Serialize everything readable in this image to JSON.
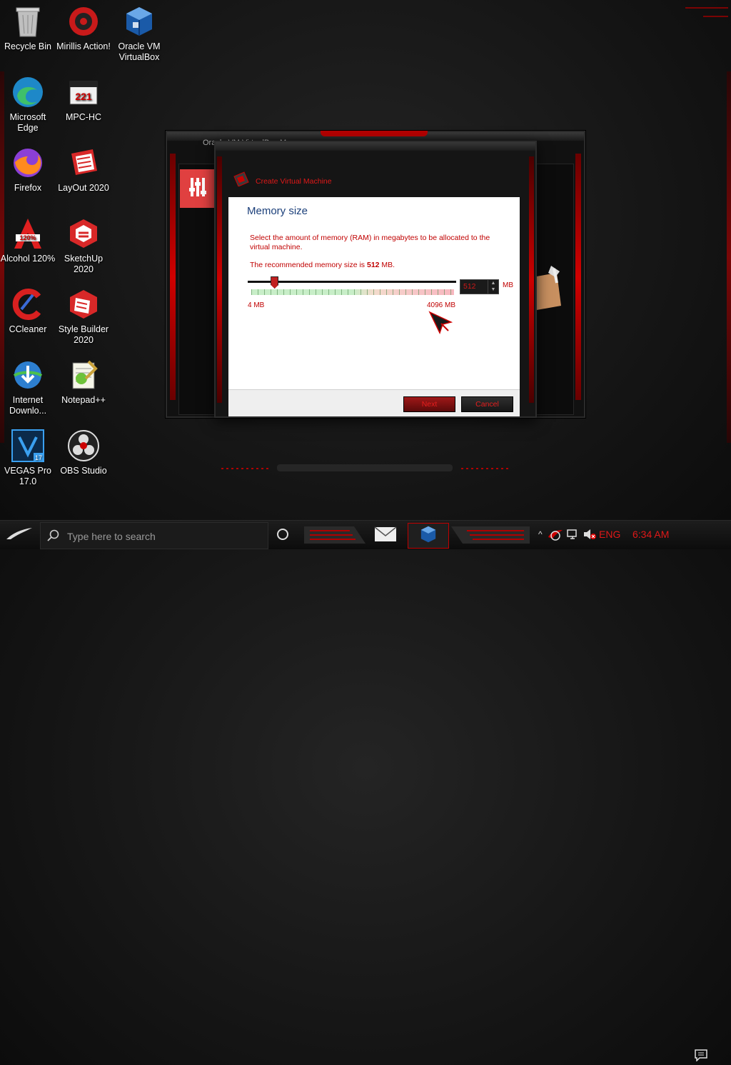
{
  "desktop": {
    "icons": [
      {
        "label": "Recycle Bin"
      },
      {
        "label": "Mirillis Action!"
      },
      {
        "label": "Oracle VM VirtualBox"
      },
      {
        "label": "Microsoft Edge"
      },
      {
        "label": "MPC-HC"
      },
      {
        "label": "Firefox"
      },
      {
        "label": "LayOut 2020"
      },
      {
        "label": "Alcohol 120%"
      },
      {
        "label": "SketchUp 2020"
      },
      {
        "label": "CCleaner"
      },
      {
        "label": "Style Builder 2020"
      },
      {
        "label": "Internet Downlo..."
      },
      {
        "label": "Notepad++"
      },
      {
        "label": "VEGAS Pro 17.0"
      },
      {
        "label": "OBS Studio"
      }
    ]
  },
  "back_window": {
    "title": "Oracle VM VirtualBox Manager"
  },
  "dialog": {
    "title": "Create Virtual Machine",
    "heading": "Memory size",
    "description": "Select the amount of memory (RAM) in megabytes to be allocated to the virtual machine.",
    "recommended_prefix": "The recommended memory size is ",
    "recommended_value": "512",
    "recommended_suffix": " MB.",
    "slider_min_label": "4 MB",
    "slider_max_label": "4096 MB",
    "memory_value": "512",
    "unit": "MB",
    "slider_fraction": 0.124,
    "next_label": "Next",
    "cancel_label": "Cancel"
  },
  "taskbar": {
    "search_placeholder": "Type here to search",
    "language": "ENG",
    "time": "6:34 AM"
  },
  "colors": {
    "accent": "#e01818",
    "heading": "#1b3f7a"
  }
}
